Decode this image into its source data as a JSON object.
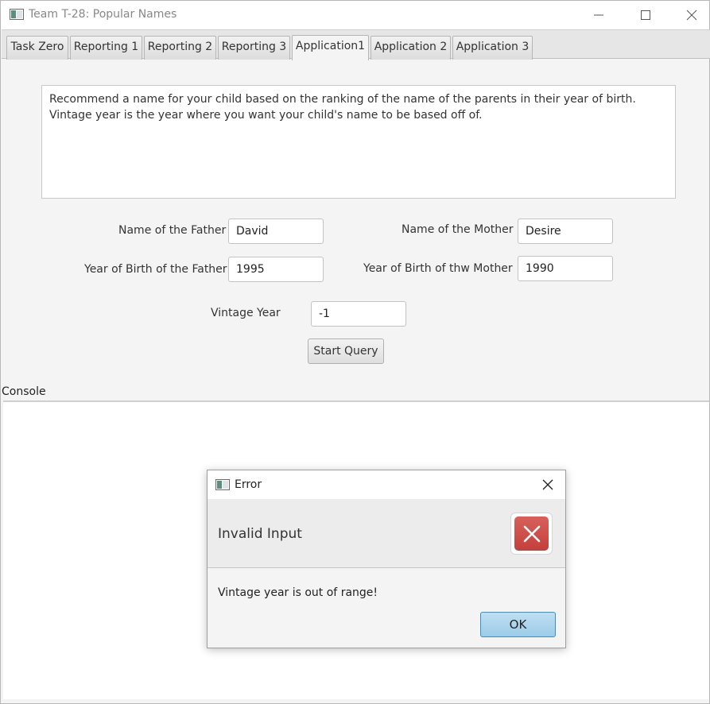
{
  "window": {
    "title": "Team T-28: Popular Names"
  },
  "tabs": [
    {
      "label": "Task Zero"
    },
    {
      "label": "Reporting 1"
    },
    {
      "label": "Reporting 2"
    },
    {
      "label": "Reporting 3"
    },
    {
      "label": "Application1",
      "active": true
    },
    {
      "label": "Application 2"
    },
    {
      "label": "Application 3"
    }
  ],
  "description": {
    "line1": "Recommend a name for your child based on the ranking of the name of the parents in their year of birth.",
    "line2": "Vintage year is the year where you want your child's name to be based off of."
  },
  "form": {
    "father_name_label": "Name of the Father",
    "father_name_value": "David",
    "mother_name_label": "Name of the Mother",
    "mother_name_value": "Desire",
    "father_year_label": "Year of Birth of the Father",
    "father_year_value": "1995",
    "mother_year_label": "Year of Birth of thw Mother",
    "mother_year_value": "1990",
    "vintage_label": "Vintage Year",
    "vintage_value": "-1",
    "start_button": "Start Query"
  },
  "console": {
    "label": "Console"
  },
  "dialog": {
    "title": "Error",
    "header": "Invalid Input",
    "message": "Vintage year is out of range!",
    "ok_button": "OK",
    "icon": "error-x-icon",
    "accent_color": "#c94a46"
  }
}
